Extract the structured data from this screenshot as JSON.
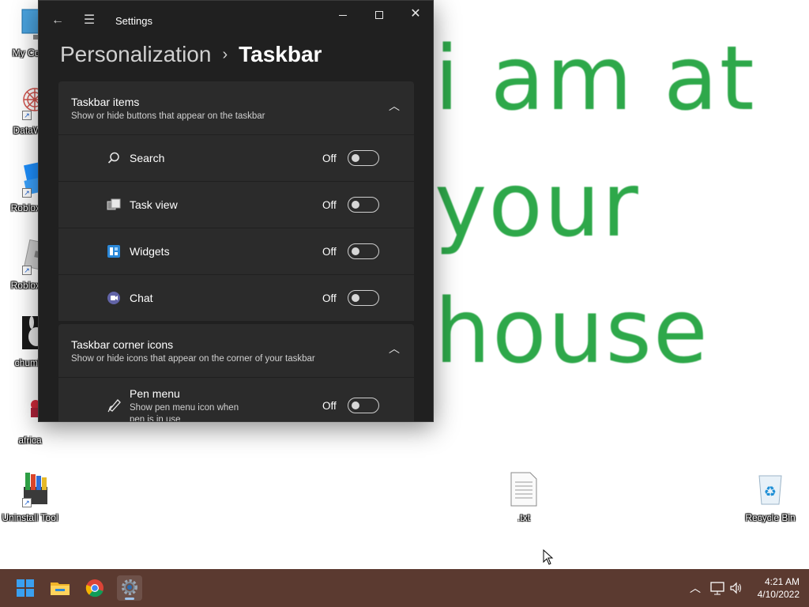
{
  "wallpaper": {
    "lines": [
      "i am at",
      "your",
      "house"
    ],
    "color": "#2ea84a"
  },
  "desktop_icons": [
    {
      "label": "My Com",
      "icon": "computer-icon"
    },
    {
      "label": "DataWa",
      "icon": "datawave-icon"
    },
    {
      "label": "Roblox S",
      "icon": "roblox-studio-icon"
    },
    {
      "label": "Roblox P",
      "icon": "roblox-player-icon"
    },
    {
      "label": "chumlo",
      "icon": "chumlo-icon"
    },
    {
      "label": "africa",
      "icon": "africa-icon"
    },
    {
      "label": "Uninstall Tool",
      "icon": "uninstall-tool-icon"
    },
    {
      "label": ".txt",
      "icon": "text-file-icon"
    },
    {
      "label": "Recycle Bin",
      "icon": "recycle-bin-icon"
    }
  ],
  "window": {
    "title": "Settings",
    "breadcrumb": {
      "parent": "Personalization",
      "separator": "›",
      "current": "Taskbar"
    },
    "groups": [
      {
        "title": "Taskbar items",
        "subtitle": "Show or hide buttons that appear on the taskbar",
        "items": [
          {
            "label": "Search",
            "state": "Off",
            "icon": "search-icon"
          },
          {
            "label": "Task view",
            "state": "Off",
            "icon": "task-view-icon"
          },
          {
            "label": "Widgets",
            "state": "Off",
            "icon": "widgets-icon"
          },
          {
            "label": "Chat",
            "state": "Off",
            "icon": "chat-icon"
          }
        ]
      },
      {
        "title": "Taskbar corner icons",
        "subtitle": "Show or hide icons that appear on the corner of your taskbar",
        "items": [
          {
            "label": "Pen menu",
            "sub": "Show pen menu icon when pen is in use",
            "state": "Off",
            "icon": "pen-icon"
          }
        ]
      }
    ]
  },
  "taskbar": {
    "apps": [
      "start-icon",
      "file-explorer-icon",
      "chrome-icon",
      "settings-icon"
    ],
    "active_app": "settings-icon",
    "clock": {
      "time": "4:21 AM",
      "date": "4/10/2022"
    },
    "background": "#5b3a30"
  },
  "colors": {
    "window_bg": "#202020",
    "card_bg": "#2b2b2b",
    "accent": "#9fc3ea"
  }
}
